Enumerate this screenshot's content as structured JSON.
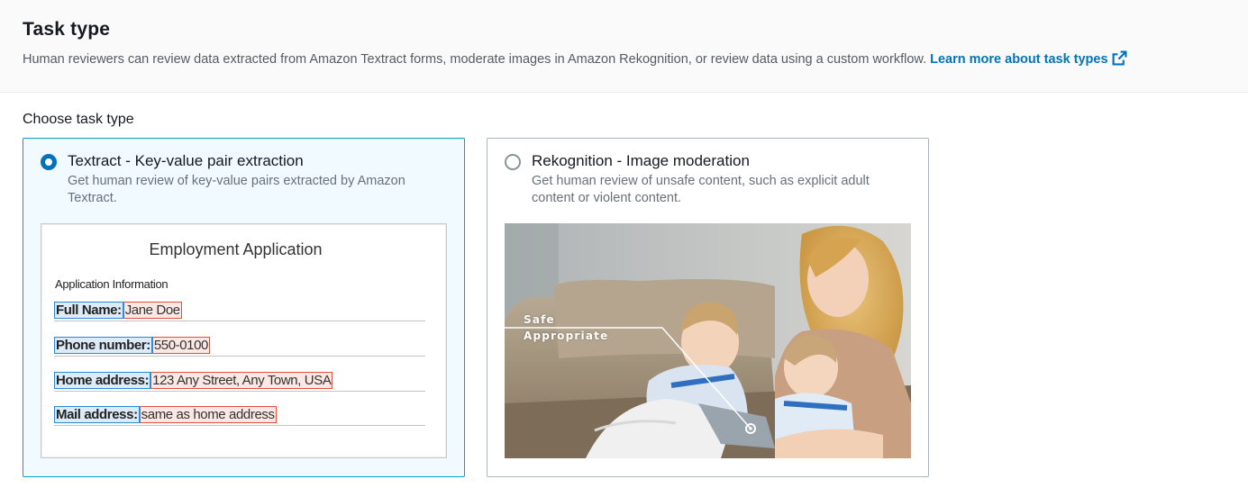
{
  "header": {
    "title": "Task type",
    "description": "Human reviewers can review data extracted from Amazon Textract forms, moderate images in Amazon Rekognition, or review data using a custom workflow.",
    "learn_more": "Learn more about task types"
  },
  "field_label": "Choose task type",
  "options": [
    {
      "title": "Textract - Key-value pair extraction",
      "description": "Get human review of key-value pairs extracted by Amazon Textract.",
      "selected": true,
      "illustration": {
        "form_title": "Employment Application",
        "section": "Application Information",
        "rows": [
          {
            "key": "Full Name:",
            "value": "Jane Doe"
          },
          {
            "key": "Phone number:",
            "value": "550-0100"
          },
          {
            "key": "Home address:",
            "value": "123 Any Street, Any Town, USA"
          },
          {
            "key": "Mail address:",
            "value": "same as home address"
          }
        ]
      }
    },
    {
      "title": "Rekognition - Image moderation",
      "description": "Get human review of unsafe content, such as explicit adult content or violent content.",
      "selected": false,
      "illustration": {
        "labels": [
          "Safe",
          "Appropriate"
        ]
      }
    }
  ],
  "colors": {
    "link": "#0073bb",
    "selected_border": "#00a1c9",
    "selected_bg": "#f1faff",
    "key_box": "#2b8ad6",
    "value_box": "#e0513b"
  }
}
